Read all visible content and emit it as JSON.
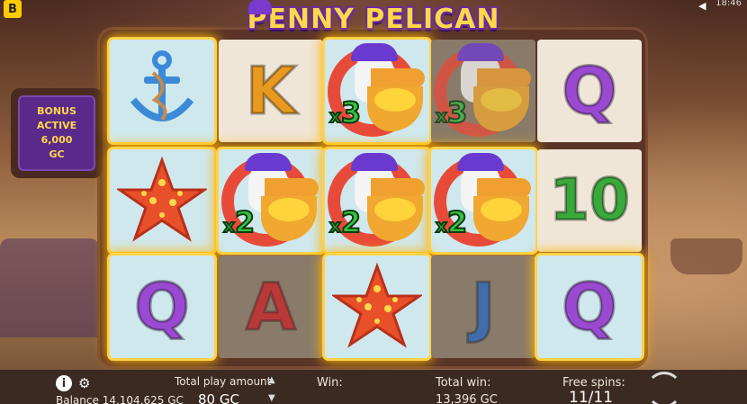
{
  "title": "PENNY PELICAN",
  "brand_badge": "B",
  "clock": "18:46",
  "bonus": {
    "line1": "BONUS",
    "line2": "ACTIVE",
    "line3": "6,000",
    "line4": "GC"
  },
  "grid": {
    "row1": [
      {
        "symbol": "anchor",
        "state": "win"
      },
      {
        "symbol": "K",
        "state": "plain",
        "color": "#e89a20"
      },
      {
        "symbol": "pelican",
        "state": "win",
        "mult": "3"
      },
      {
        "symbol": "pelican",
        "state": "dim",
        "mult": "3"
      },
      {
        "symbol": "Q",
        "state": "plain",
        "color": "#9a4ad0"
      }
    ],
    "row2": [
      {
        "symbol": "starfish",
        "state": "win"
      },
      {
        "symbol": "pelican",
        "state": "win",
        "mult": "2"
      },
      {
        "symbol": "pelican",
        "state": "win",
        "mult": "2"
      },
      {
        "symbol": "pelican",
        "state": "win",
        "mult": "2"
      },
      {
        "symbol": "10",
        "state": "plain",
        "color": "#3aa83a"
      }
    ],
    "row3": [
      {
        "symbol": "Q",
        "state": "win",
        "color": "#9a4ad0"
      },
      {
        "symbol": "A",
        "state": "dim",
        "color": "#c8242a"
      },
      {
        "symbol": "starfish",
        "state": "win"
      },
      {
        "symbol": "J",
        "state": "dim",
        "color": "#2a6ac0"
      },
      {
        "symbol": "Q",
        "state": "win",
        "color": "#9a4ad0"
      }
    ]
  },
  "hud": {
    "balance_label": "Balance",
    "balance_value": "14,104,625 GC",
    "total_play_label": "Total play amount",
    "total_play_value": "80 GC",
    "win_label": "Win:",
    "total_win_label": "Total win:",
    "total_win_value": "13,396 GC",
    "free_spins_label": "Free spins:",
    "free_spins_value": "11/11"
  },
  "multiplier_prefix": "x",
  "colors": {
    "win_glow": "#ffd24a",
    "multiplier": "#3ac040"
  }
}
